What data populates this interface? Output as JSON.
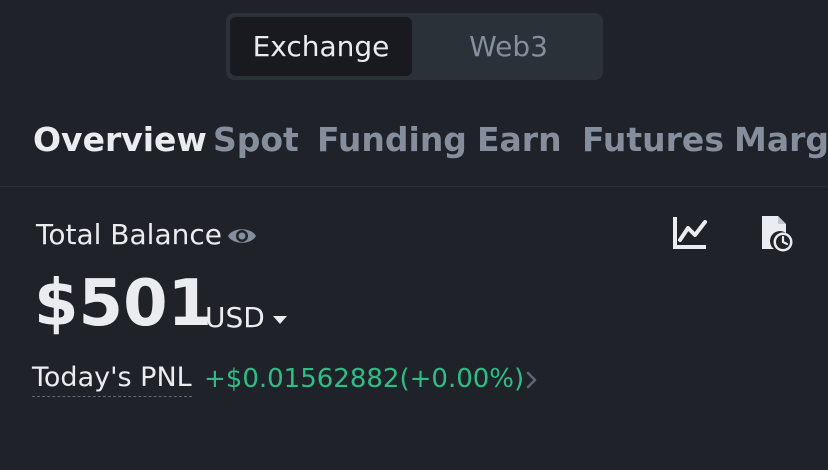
{
  "mode_switch": {
    "options": [
      {
        "label": "Exchange",
        "selected": true
      },
      {
        "label": "Web3",
        "selected": false
      }
    ]
  },
  "tabs": [
    {
      "label": "Overview",
      "active": true
    },
    {
      "label": "Spot",
      "active": false
    },
    {
      "label": "Funding",
      "active": false
    },
    {
      "label": "Earn",
      "active": false
    },
    {
      "label": "Futures",
      "active": false
    },
    {
      "label": "Margin",
      "active": false
    }
  ],
  "balance": {
    "label": "Total Balance",
    "amount": "$501",
    "currency": "USD"
  },
  "pnl": {
    "label": "Today's PNL",
    "value": "+$0.01562882(+0.00%)"
  },
  "icons": {
    "visibility": "eye-icon",
    "chart": "chart-icon",
    "history": "history-icon",
    "currency_dropdown": "caret-down-icon",
    "pnl_details": "chevron-right-icon"
  },
  "colors": {
    "background": "#1f2329",
    "text_primary": "#eaecef",
    "text_secondary": "#848e9c",
    "positive": "#2ebd85",
    "segment_active_bg": "#181a20"
  }
}
